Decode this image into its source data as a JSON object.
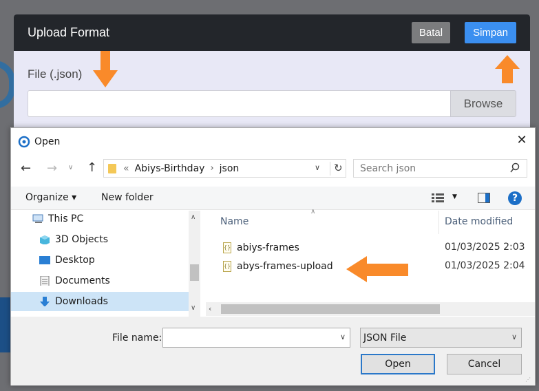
{
  "modal": {
    "title": "Upload Format",
    "cancel_label": "Batal",
    "save_label": "Simpan",
    "file_label": "File (.json)",
    "browse_label": "Browse",
    "file_value": ""
  },
  "dialog": {
    "title": "Open",
    "breadcrumb": [
      "«",
      "Abiys-Birthday",
      "json"
    ],
    "search_placeholder": "Search json",
    "organize_label": "Organize ▾",
    "new_folder_label": "New folder",
    "help_label": "?",
    "tree": [
      {
        "label": "This PC",
        "icon": "pc-icon"
      },
      {
        "label": "3D Objects",
        "icon": "3d-objects-icon"
      },
      {
        "label": "Desktop",
        "icon": "desktop-icon"
      },
      {
        "label": "Documents",
        "icon": "documents-icon"
      },
      {
        "label": "Downloads",
        "icon": "downloads-icon",
        "selected": true
      }
    ],
    "columns": {
      "name": "Name",
      "date": "Date modified"
    },
    "files": [
      {
        "name": "abiys-frames",
        "date": "01/03/2025 2:03"
      },
      {
        "name": "abys-frames-upload",
        "date": "01/03/2025 2:04"
      }
    ],
    "file_name_label": "File name:",
    "file_name_value": "",
    "file_type": "JSON File",
    "open_label": "Open",
    "cancel_label": "Cancel"
  },
  "colors": {
    "accent_arrow": "#f98a2a",
    "simpan": "#3b8ff0",
    "header": "#23262b"
  }
}
